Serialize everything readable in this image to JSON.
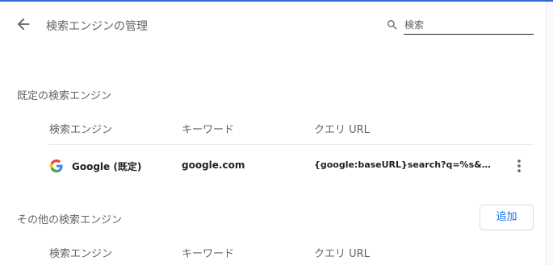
{
  "header": {
    "title": "検索エンジンの管理",
    "search_placeholder": "検索"
  },
  "default_section": {
    "title": "既定の検索エンジン",
    "columns": [
      "検索エンジン",
      "キーワード",
      "クエリ URL"
    ],
    "rows": [
      {
        "name": "Google (既定)",
        "keyword": "google.com",
        "url": "{google:baseURL}search?q=%s&{go…",
        "icon": "google-logo"
      }
    ]
  },
  "other_section": {
    "title": "その他の検索エンジン",
    "add_label": "追加",
    "columns": [
      "検索エンジン",
      "キーワード",
      "クエリ URL"
    ]
  },
  "colors": {
    "accent": "#1a73e8",
    "top_line": "#3367d6",
    "secondary_text": "#5f6368"
  },
  "icons": [
    "arrow-back-icon",
    "search-icon",
    "google-logo-icon",
    "more-vert-icon"
  ]
}
